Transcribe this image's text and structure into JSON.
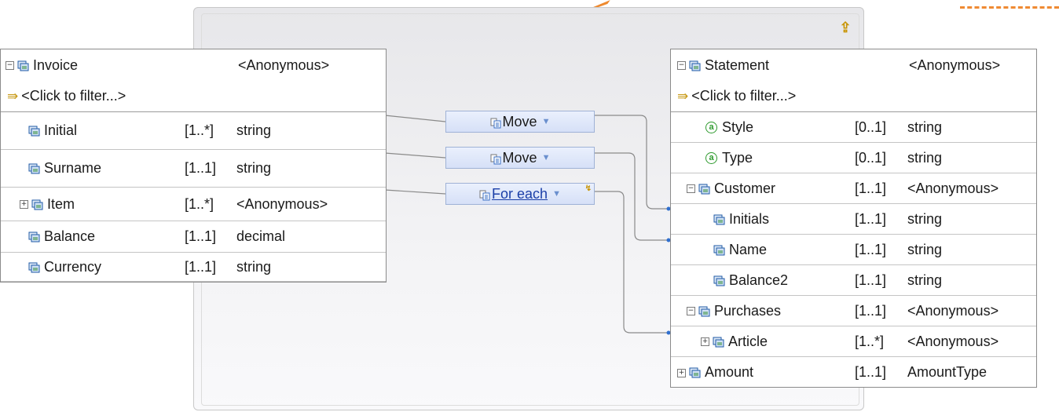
{
  "source": {
    "name": "Invoice",
    "type": "<Anonymous>",
    "filter": "<Click to filter...>",
    "rows": [
      {
        "name": "Initial",
        "card": "[1..*]",
        "type": "string",
        "expander": ""
      },
      {
        "name": "Surname",
        "card": "[1..1]",
        "type": "string",
        "expander": ""
      },
      {
        "name": "Item",
        "card": "[1..*]",
        "type": "<Anonymous>",
        "expander": "+"
      },
      {
        "name": "Balance",
        "card": "[1..1]",
        "type": "decimal",
        "expander": ""
      },
      {
        "name": "Currency",
        "card": "[1..1]",
        "type": "string",
        "expander": ""
      }
    ]
  },
  "target": {
    "name": "Statement",
    "type": "<Anonymous>",
    "filter": "<Click to filter...>",
    "rows": [
      {
        "name": "Style",
        "card": "[0..1]",
        "type": "string",
        "kind": "attribute",
        "expander": ""
      },
      {
        "name": "Type",
        "card": "[0..1]",
        "type": "string",
        "kind": "attribute",
        "expander": ""
      },
      {
        "name": "Customer",
        "card": "[1..1]",
        "type": "<Anonymous>",
        "kind": "element",
        "expander": "-"
      },
      {
        "name": "Initials",
        "card": "[1..1]",
        "type": "string",
        "kind": "element",
        "expander": ""
      },
      {
        "name": "Name",
        "card": "[1..1]",
        "type": "string",
        "kind": "element",
        "expander": ""
      },
      {
        "name": "Balance2",
        "card": "[1..1]",
        "type": "string",
        "kind": "element",
        "expander": ""
      },
      {
        "name": "Purchases",
        "card": "[1..1]",
        "type": "<Anonymous>",
        "kind": "element",
        "expander": "-"
      },
      {
        "name": "Article",
        "card": "[1..*]",
        "type": "<Anonymous>",
        "kind": "element",
        "expander": "+"
      },
      {
        "name": "Amount",
        "card": "[1..1]",
        "type": "AmountType",
        "kind": "element",
        "expander": "+"
      }
    ]
  },
  "transforms": [
    {
      "label": "Move"
    },
    {
      "label": "Move"
    },
    {
      "label": "For each"
    }
  ],
  "icons": {
    "attribute": "attribute-icon",
    "element": "element-icon",
    "filter": "filter-icon",
    "up": "up-arrow-icon",
    "dropdown": "dropdown-icon"
  },
  "colors": {
    "wire": "#808080",
    "wire_dot": "#2f6fcf",
    "transform_bg": "#dde6fa",
    "link": "#1b3fa8",
    "accent_orange": "#ee8a2f"
  }
}
